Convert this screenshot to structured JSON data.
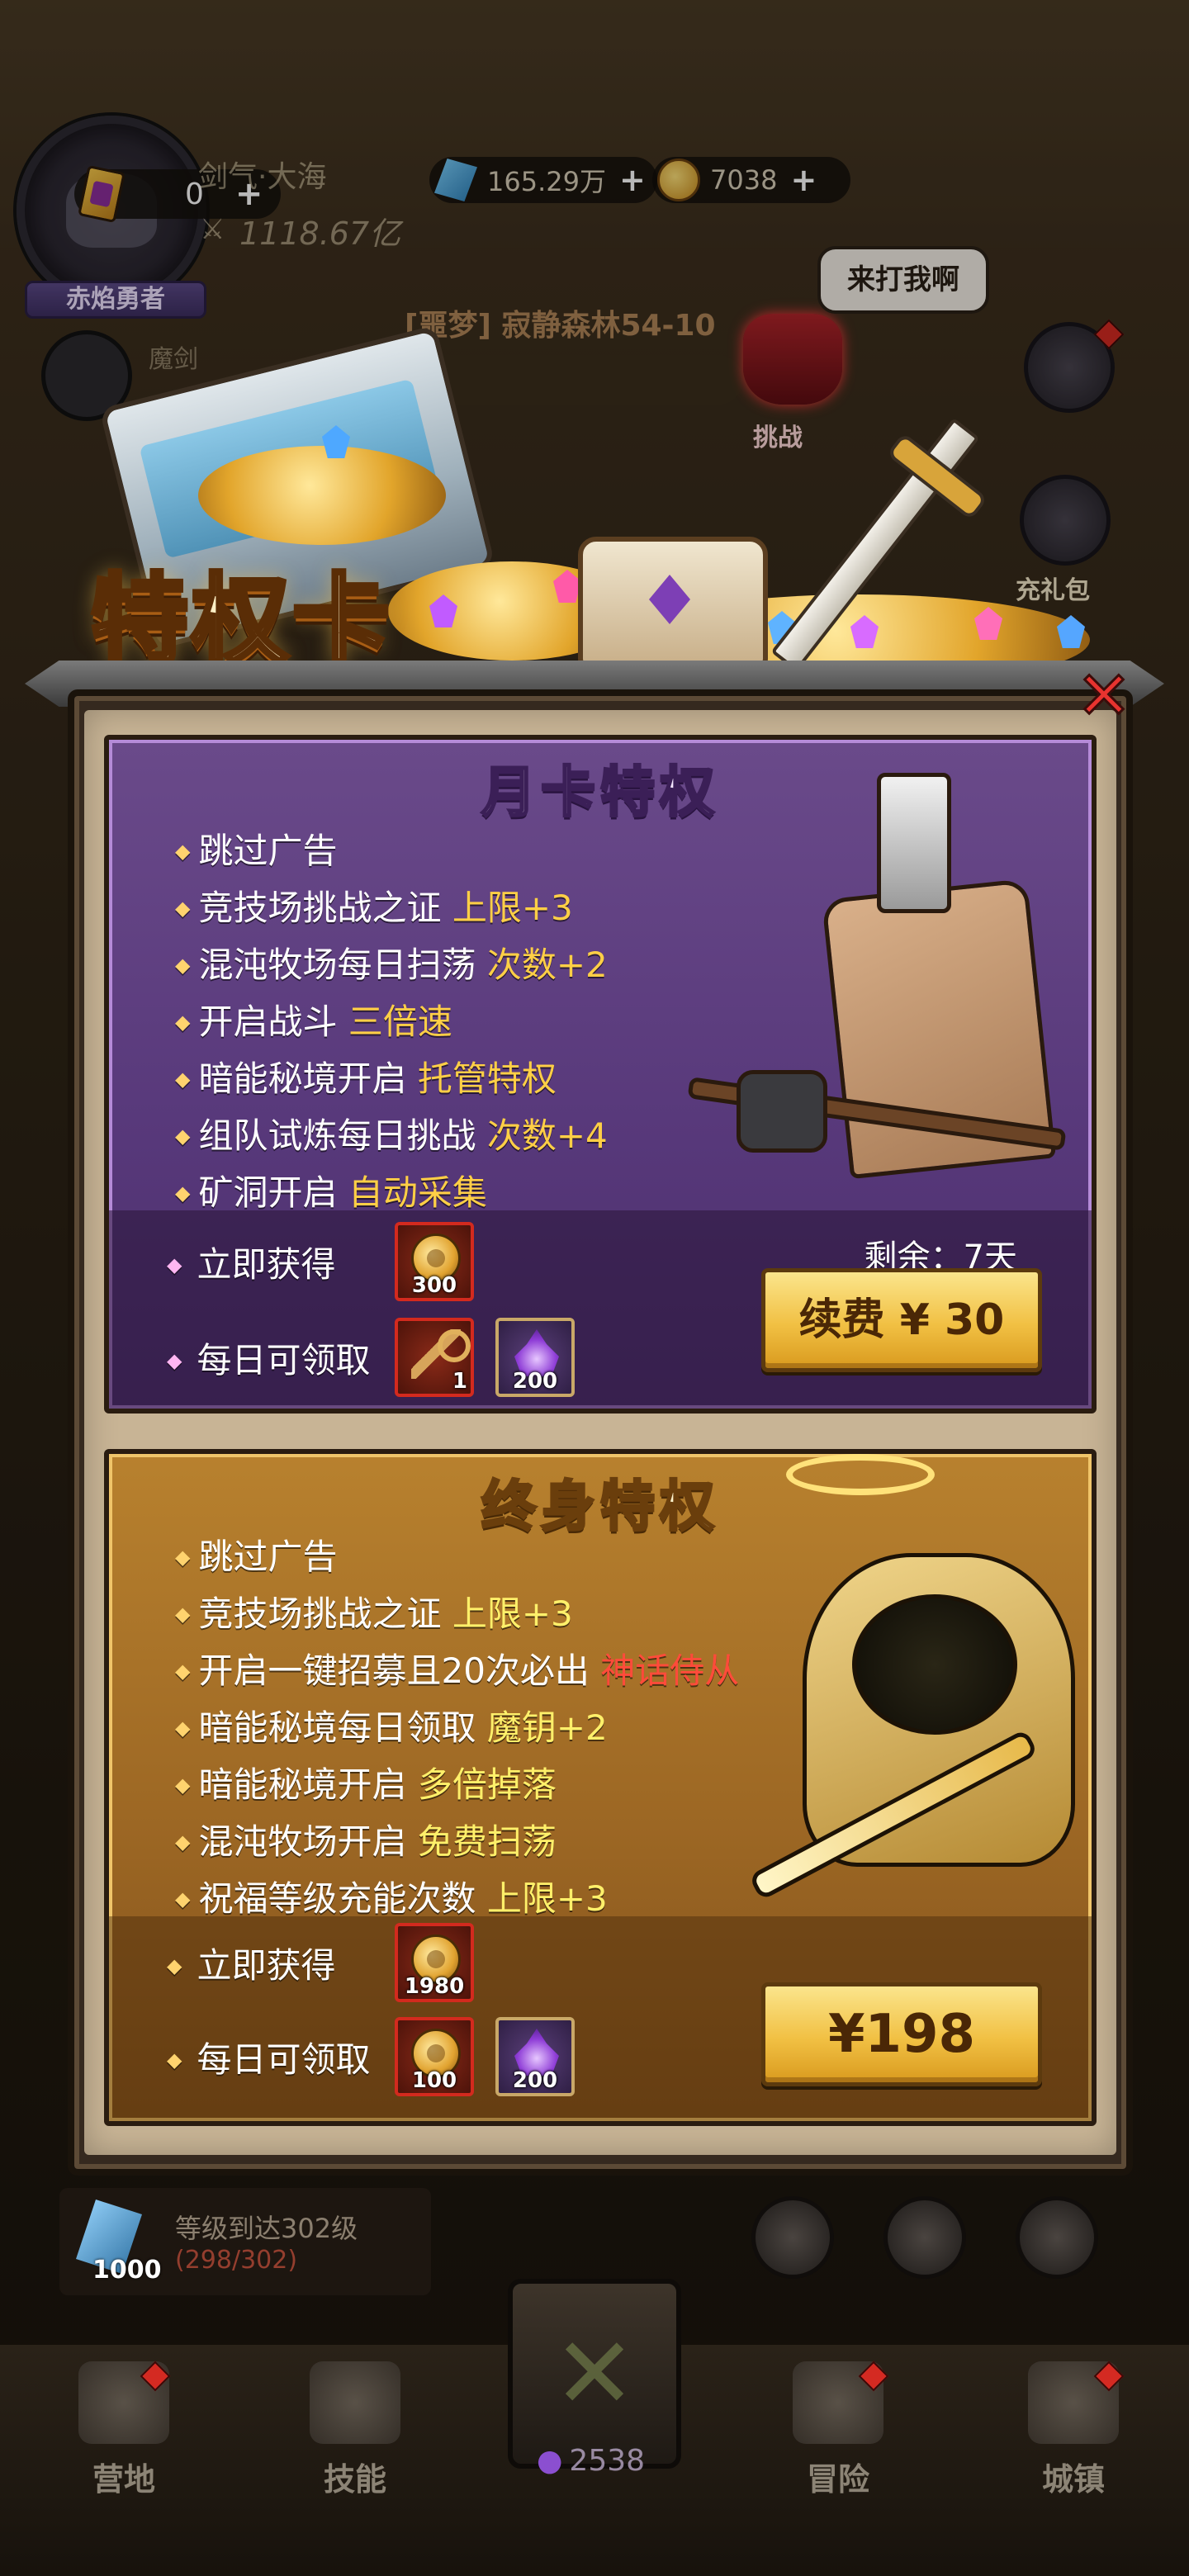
{
  "hud": {
    "card_count": "0",
    "player_name": "剑气·大海",
    "power": "1118.67亿",
    "gems": "165.29万",
    "gold": "7038",
    "rank_title": "赤焰勇者",
    "stage": "[噩梦] 寂静森林54-10",
    "taunt": "来打我啊",
    "challenge_label": "挑战",
    "gift_label": "充礼包",
    "companion_name": "魔剑"
  },
  "modal": {
    "title": "特权卡"
  },
  "monthly": {
    "title": "月卡特权",
    "perks": [
      {
        "text": "跳过广告",
        "highlight": ""
      },
      {
        "text": "竞技场挑战之证 ",
        "highlight": "上限+3"
      },
      {
        "text": "混沌牧场每日扫荡 ",
        "highlight": "次数+2"
      },
      {
        "text": "开启战斗 ",
        "highlight": "三倍速"
      },
      {
        "text": "暗能秘境开启 ",
        "highlight": "托管特权"
      },
      {
        "text": "组队试炼每日挑战 ",
        "highlight": "次数+4"
      },
      {
        "text": "矿洞开启 ",
        "highlight": "自动采集"
      }
    ],
    "instant_label": "立即获得",
    "daily_label": "每日可领取",
    "instant_items": [
      {
        "icon": "gold-coin",
        "qty": "300"
      }
    ],
    "daily_items": [
      {
        "icon": "key",
        "qty": "1"
      },
      {
        "icon": "purple-flame",
        "qty": "200"
      }
    ],
    "remaining": "剩余：7天",
    "button": "续费 ¥ 30"
  },
  "lifetime": {
    "title": "终身特权",
    "perks": [
      {
        "text": "跳过广告",
        "highlight": "",
        "red": ""
      },
      {
        "text": "竞技场挑战之证 ",
        "highlight": "上限+3",
        "red": ""
      },
      {
        "text": "开启一键招募且20次必出 ",
        "highlight": "",
        "red": "神话侍从"
      },
      {
        "text": "暗能秘境每日领取 ",
        "highlight": "魔钥+2",
        "red": ""
      },
      {
        "text": "暗能秘境开启 ",
        "highlight": "多倍掉落",
        "red": ""
      },
      {
        "text": "混沌牧场开启 ",
        "highlight": "免费扫荡",
        "red": ""
      },
      {
        "text": "祝福等级充能次数 ",
        "highlight": "上限+3",
        "red": ""
      }
    ],
    "instant_label": "立即获得",
    "daily_label": "每日可领取",
    "instant_items": [
      {
        "icon": "gold-coin",
        "qty": "1980"
      }
    ],
    "daily_items": [
      {
        "icon": "gold-coin",
        "qty": "100"
      },
      {
        "icon": "purple-flame",
        "qty": "200"
      }
    ],
    "button": "¥198"
  },
  "bottom": {
    "level_gem_qty": "1000",
    "level_title": "等级到达302级",
    "level_progress": "(298/302)",
    "center_count": "2538",
    "nav": [
      "营地",
      "技能",
      "冒险",
      "城镇"
    ]
  },
  "colors": {
    "monthly_bg": "#57387a",
    "lifetime_bg": "#9a6523",
    "highlight_gold": "#ffcf46",
    "highlight_red": "#ff4b3a",
    "button_gold": "#f1c043",
    "close_red": "#e8332f"
  }
}
